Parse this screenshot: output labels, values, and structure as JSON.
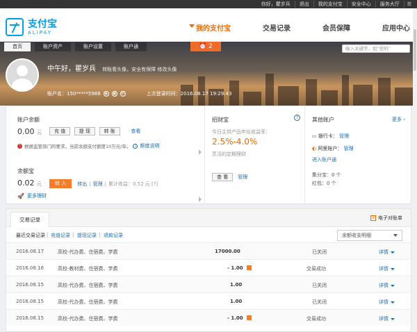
{
  "topbar": {
    "greeting": "你好，瞿岁兵",
    "logout": "退出",
    "my_alipay": "我的支付宝",
    "security": "安全中心",
    "services": "服务大厅",
    "menu_icon": "menu-icon"
  },
  "logo": {
    "cn": "支付宝",
    "en": "ALIPAY"
  },
  "mainnav": [
    "我的支付宝",
    "交易记录",
    "会员保障",
    "应用中心"
  ],
  "subnav": [
    "首页",
    "账户资产",
    "账户设置",
    "账户通"
  ],
  "search": {
    "placeholder": "输入关键字，如“密码”"
  },
  "alarm": {
    "count": "2",
    "icon": "alarm-clock-icon"
  },
  "profile": {
    "greeting": "中午好，瞿岁兵",
    "tagline": "转账看头像，安全有保障 修改头像",
    "account_label": "账户名：150*****5988",
    "last_login": "上次登录时间：2016.08.17 19:29:43"
  },
  "balance": {
    "title": "账户余额",
    "amount": "0.00",
    "unit": "元",
    "buttons": [
      "充 值",
      "提 现",
      "转 账"
    ],
    "view_link": "查看",
    "notice": "根据监管部门的要求，当前余额支付额度10万元/年。",
    "notice_link": "额度说明"
  },
  "yuebao": {
    "title": "余额宝",
    "amount": "0.02",
    "unit": "元",
    "transfer_in": "转 入",
    "transfer_out": "转出",
    "manage": "管理",
    "earnings": "累计收益：0.52 元 [?]",
    "more": "更多理财"
  },
  "zhaocaibao": {
    "title": "招财宝",
    "subtitle": "今日主供产品年化收益率：",
    "rate": "2.5%-4.0%",
    "note": "灵活的定期理财",
    "view_button": "查 看",
    "manage": "管理"
  },
  "other_accounts": {
    "title": "其他账户",
    "more": "更多",
    "bank_card": "银行卡：",
    "bank_manage": "管理",
    "alibaba": "阿里账户：",
    "alibaba_manage": "管理",
    "enter_account": "进入账户通",
    "jibao": "集分宝：0 个",
    "hongbao": "红包：0 个"
  },
  "transactions": {
    "tab": "交易记录",
    "ebill": "电子对账单",
    "filters": [
      "最近交易记录",
      "充值记录",
      "提现记录",
      "退款记录"
    ],
    "dropdown": "余额收支明细",
    "rows": [
      {
        "date": "2016.08.17",
        "desc": "高校-代办费、住宿费、学费",
        "amount": "17000.00",
        "status": "已关闭",
        "detail": "详情"
      },
      {
        "date": "2016.08.16",
        "desc": "高校-教材费、住宿费、学费",
        "amount": "- 1.00",
        "status": "交易成功",
        "detail": "详情"
      },
      {
        "date": "2016.08.15",
        "desc": "高校-代办费、住宿费、学费",
        "amount": "1.00",
        "status": "已关闭",
        "detail": "详情"
      },
      {
        "date": "2016.08.15",
        "desc": "高校-代办费、住宿费、学费",
        "amount": "1.00",
        "status": "已关闭",
        "detail": "详情"
      },
      {
        "date": "2016.08.15",
        "desc": "高校-代办费、住宿费、学费",
        "amount": "- 1.00",
        "status": "交易成功",
        "detail": "详情"
      }
    ]
  },
  "colors": {
    "accent": "#f56a00",
    "brand": "#00a0e9",
    "link": "#1b6fb8"
  }
}
